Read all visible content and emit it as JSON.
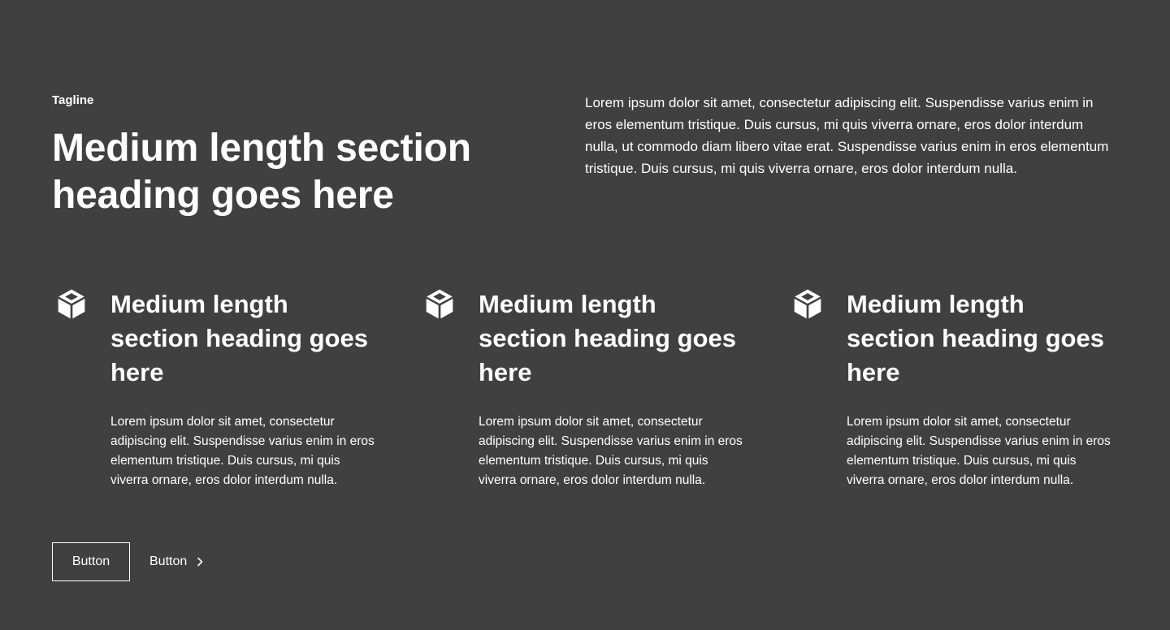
{
  "header": {
    "tagline": "Tagline",
    "heading": "Medium length section heading goes here",
    "intro": "Lorem ipsum dolor sit amet, consectetur adipiscing elit. Suspendisse varius enim in eros elementum tristique. Duis cursus, mi quis viverra ornare, eros dolor interdum nulla, ut commodo diam libero vitae erat. Suspendisse varius enim in eros elementum tristique. Duis cursus, mi quis viverra ornare, eros dolor interdum nulla."
  },
  "features": [
    {
      "icon": "cube-icon",
      "heading": "Medium length section heading goes here",
      "text": "Lorem ipsum dolor sit amet, consectetur adipiscing elit. Suspendisse varius enim in eros elementum tristique. Duis cursus, mi quis viverra ornare, eros dolor interdum nulla."
    },
    {
      "icon": "cube-icon",
      "heading": "Medium length section heading goes here",
      "text": "Lorem ipsum dolor sit amet, consectetur adipiscing elit. Suspendisse varius enim in eros elementum tristique. Duis cursus, mi quis viverra ornare, eros dolor interdum nulla."
    },
    {
      "icon": "cube-icon",
      "heading": "Medium length section heading goes here",
      "text": "Lorem ipsum dolor sit amet, consectetur adipiscing elit. Suspendisse varius enim in eros elementum tristique. Duis cursus, mi quis viverra ornare, eros dolor interdum nulla."
    }
  ],
  "actions": {
    "primary_label": "Button",
    "secondary_label": "Button",
    "secondary_icon": "chevron-right-icon"
  },
  "colors": {
    "background": "#404040",
    "foreground": "#ffffff"
  }
}
